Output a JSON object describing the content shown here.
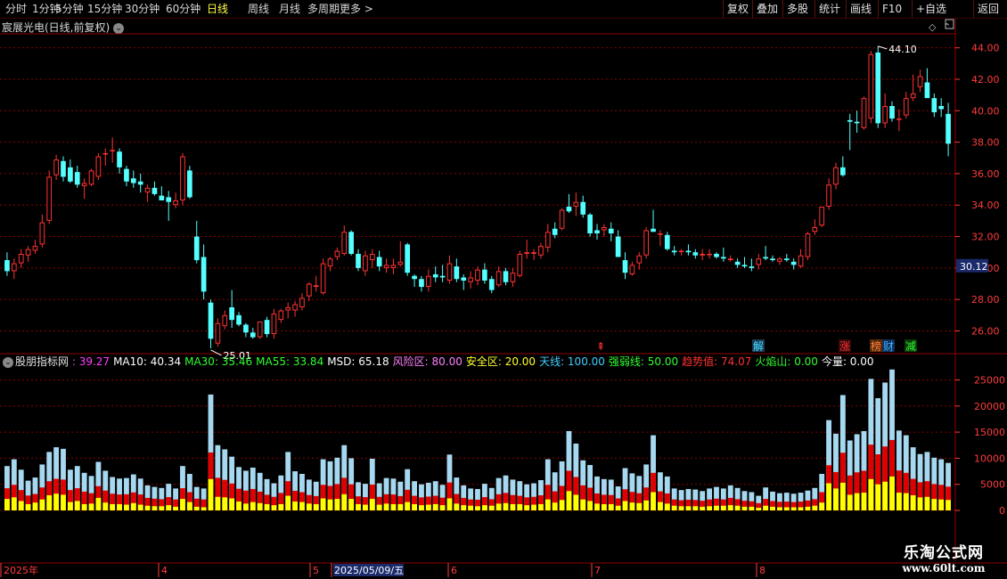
{
  "toolbar": {
    "left": [
      "分时",
      "1分钟",
      "5分钟",
      "15分钟",
      "30分钟",
      "60分钟",
      "日线",
      "周线",
      "月线",
      "多周期",
      "更多 >"
    ],
    "selected": "日线",
    "right": [
      "复权",
      "叠加",
      "多股",
      "统计",
      "画线",
      "F10",
      "+自选",
      "返回"
    ]
  },
  "stock": {
    "title": "宸展光电(日线,前复权)"
  },
  "price_axis": {
    "ticks": [
      "44.00",
      "42.00",
      "40.00",
      "38.00",
      "36.00",
      "34.00",
      "32.00",
      "30.00",
      "28.00",
      "26.00"
    ],
    "current": "30.12"
  },
  "annotations": {
    "high": "44.10",
    "low": "25.01"
  },
  "signals": [
    {
      "text": "⇞",
      "color": "#ff3030"
    },
    {
      "text": "解",
      "color": "#40e0ff"
    },
    {
      "text": "涨",
      "color": "#ff3030"
    },
    {
      "text": "榜",
      "color": "#ff8040"
    },
    {
      "text": "财",
      "color": "#40b0ff"
    },
    {
      "text": "减",
      "color": "#30ff30"
    }
  ],
  "indicator": {
    "name": "股朋指标网",
    "values": [
      {
        "text": ": 39.27",
        "color": "#ff40ff"
      },
      {
        "text": "MA10: 40.34",
        "color": "#ffffff"
      },
      {
        "text": "MA30: 35.46",
        "color": "#30ff30"
      },
      {
        "text": "MA55: 33.84",
        "color": "#30ff30"
      },
      {
        "text": "MSD: 65.18",
        "color": "#ffffff"
      },
      {
        "text": "风险区: 80.00",
        "color": "#ff80ff"
      },
      {
        "text": "安全区: 20.00",
        "color": "#ffff30"
      },
      {
        "text": "天线: 100.00",
        "color": "#40d0ff"
      },
      {
        "text": "强弱线: 50.00",
        "color": "#30ff30"
      },
      {
        "text": "趋势值: 74.07",
        "color": "#ff3030"
      },
      {
        "text": "火焰山: 0.00",
        "color": "#30ff30"
      },
      {
        "text": "今量: 0.00",
        "color": "#ffffff"
      }
    ]
  },
  "volume_axis": {
    "ticks": [
      "25000",
      "20000",
      "15000",
      "10000",
      "5000",
      "0"
    ]
  },
  "date_axis": [
    "2025年",
    "4",
    "5",
    "2025/05/09/五",
    "6",
    "7",
    "8"
  ],
  "watermark": {
    "line1": "乐淘公式网",
    "line2": "www.60lt.com"
  },
  "colors": {
    "up": "#ff3232",
    "down": "#54ffff",
    "grid": "#8b0000",
    "yellow": "#ffff00",
    "lightblue": "#a6d8f0"
  },
  "chart_data": {
    "type": "candlestick",
    "ylim": [
      24.5,
      45.0
    ],
    "candles": [
      [
        30.5,
        31.0,
        29.5,
        29.8
      ],
      [
        29.8,
        30.6,
        29.3,
        30.3
      ],
      [
        30.3,
        31.2,
        30.0,
        30.9
      ],
      [
        30.8,
        31.4,
        30.4,
        31.2
      ],
      [
        31.1,
        31.8,
        30.9,
        31.4
      ],
      [
        31.5,
        33.4,
        31.3,
        32.9
      ],
      [
        33.0,
        36.2,
        32.8,
        35.8
      ],
      [
        35.9,
        37.2,
        35.6,
        36.9
      ],
      [
        36.8,
        37.1,
        35.5,
        35.8
      ],
      [
        36.4,
        36.9,
        35.4,
        35.5
      ],
      [
        36.1,
        36.5,
        35.1,
        35.3
      ],
      [
        35.2,
        35.7,
        34.4,
        35.4
      ],
      [
        35.3,
        36.3,
        35.2,
        36.2
      ],
      [
        35.8,
        37.3,
        35.6,
        37.1
      ],
      [
        37.3,
        37.6,
        36.5,
        37.3
      ],
      [
        37.5,
        38.3,
        36.7,
        37.5
      ],
      [
        37.4,
        37.6,
        36.0,
        36.4
      ],
      [
        36.3,
        36.5,
        35.2,
        35.5
      ],
      [
        35.7,
        36.2,
        35.1,
        35.4
      ],
      [
        35.5,
        36.0,
        34.8,
        35.3
      ],
      [
        34.8,
        35.3,
        34.2,
        35.1
      ],
      [
        35.1,
        35.5,
        34.6,
        34.7
      ],
      [
        34.6,
        35.2,
        34.3,
        34.3
      ],
      [
        34.5,
        34.9,
        33.0,
        34.2
      ],
      [
        34.0,
        34.8,
        33.8,
        34.3
      ],
      [
        34.3,
        37.3,
        34.0,
        37.1
      ],
      [
        36.2,
        36.5,
        34.4,
        34.5
      ],
      [
        32.0,
        33.0,
        30.3,
        30.5
      ],
      [
        30.7,
        31.5,
        28.0,
        28.5
      ],
      [
        27.8,
        28.0,
        24.9,
        25.5
      ],
      [
        25.2,
        26.8,
        25.0,
        26.5
      ],
      [
        26.3,
        27.3,
        26.1,
        27.0
      ],
      [
        27.5,
        28.6,
        26.2,
        26.7
      ],
      [
        27.0,
        27.2,
        26.3,
        26.4
      ],
      [
        26.4,
        26.5,
        25.6,
        25.9
      ],
      [
        25.9,
        26.2,
        25.5,
        25.6
      ],
      [
        25.6,
        26.6,
        25.5,
        26.6
      ],
      [
        26.7,
        26.9,
        25.6,
        25.8
      ],
      [
        25.8,
        27.4,
        25.5,
        27.1
      ],
      [
        26.7,
        27.4,
        26.5,
        27.3
      ],
      [
        27.3,
        27.8,
        26.8,
        27.5
      ],
      [
        27.3,
        27.9,
        26.9,
        27.7
      ],
      [
        27.5,
        28.4,
        27.3,
        28.1
      ],
      [
        28.2,
        29.1,
        27.9,
        29.0
      ],
      [
        28.8,
        29.5,
        28.5,
        28.9
      ],
      [
        28.4,
        30.6,
        28.3,
        30.3
      ],
      [
        30.1,
        30.7,
        29.8,
        30.6
      ],
      [
        30.7,
        31.3,
        30.5,
        31.1
      ],
      [
        30.9,
        32.7,
        30.8,
        32.3
      ],
      [
        32.3,
        32.4,
        30.8,
        30.9
      ],
      [
        30.9,
        31.2,
        29.8,
        30.0
      ],
      [
        29.8,
        31.1,
        29.5,
        30.8
      ],
      [
        30.5,
        31.2,
        30.0,
        30.9
      ],
      [
        30.7,
        31.1,
        29.8,
        30.1
      ],
      [
        30.0,
        30.6,
        29.7,
        30.2
      ],
      [
        30.0,
        30.6,
        29.6,
        30.2
      ],
      [
        30.2,
        31.7,
        30.1,
        30.4
      ],
      [
        31.5,
        31.6,
        29.5,
        29.7
      ],
      [
        29.5,
        29.6,
        28.8,
        29.3
      ],
      [
        29.3,
        29.5,
        28.5,
        28.8
      ],
      [
        28.8,
        29.9,
        28.5,
        29.5
      ],
      [
        29.6,
        30.1,
        29.1,
        29.4
      ],
      [
        29.5,
        30.2,
        29.1,
        29.4
      ],
      [
        29.2,
        30.8,
        29.0,
        30.3
      ],
      [
        30.1,
        30.6,
        29.1,
        29.3
      ],
      [
        29.4,
        29.6,
        28.6,
        29.2
      ],
      [
        29.1,
        29.8,
        28.7,
        29.4
      ],
      [
        29.2,
        30.1,
        28.9,
        29.9
      ],
      [
        29.9,
        30.3,
        29.0,
        29.2
      ],
      [
        29.3,
        29.5,
        28.4,
        28.6
      ],
      [
        28.9,
        30.1,
        28.8,
        29.8
      ],
      [
        29.8,
        30.0,
        28.9,
        29.1
      ],
      [
        29.1,
        30.0,
        28.8,
        29.7
      ],
      [
        29.5,
        31.1,
        29.4,
        30.9
      ],
      [
        30.9,
        31.8,
        30.6,
        31.0
      ],
      [
        30.9,
        31.2,
        30.5,
        31.0
      ],
      [
        30.8,
        31.6,
        30.6,
        31.4
      ],
      [
        31.3,
        32.8,
        31.0,
        32.3
      ],
      [
        32.5,
        32.9,
        31.9,
        32.1
      ],
      [
        32.5,
        33.8,
        32.4,
        33.7
      ],
      [
        33.9,
        34.7,
        33.5,
        33.6
      ],
      [
        33.9,
        34.8,
        33.3,
        34.2
      ],
      [
        34.2,
        34.6,
        33.2,
        33.4
      ],
      [
        33.4,
        33.5,
        32.0,
        32.2
      ],
      [
        32.4,
        32.8,
        31.8,
        32.2
      ],
      [
        32.4,
        32.8,
        32.0,
        32.6
      ],
      [
        32.5,
        32.9,
        31.7,
        32.2
      ],
      [
        32.0,
        32.4,
        31.0,
        30.7
      ],
      [
        30.5,
        31.0,
        29.3,
        29.7
      ],
      [
        29.6,
        30.4,
        29.5,
        30.2
      ],
      [
        30.3,
        31.0,
        29.9,
        30.8
      ],
      [
        30.8,
        32.6,
        30.6,
        32.4
      ],
      [
        32.5,
        33.7,
        32.3,
        32.3
      ],
      [
        32.2,
        32.4,
        31.4,
        32.2
      ],
      [
        32.1,
        32.3,
        31.1,
        31.2
      ],
      [
        31.1,
        31.4,
        30.8,
        31.0
      ],
      [
        31.1,
        31.2,
        30.8,
        31.1
      ],
      [
        31.1,
        31.5,
        30.8,
        31.0
      ],
      [
        31.0,
        31.2,
        30.6,
        30.8
      ],
      [
        30.8,
        31.2,
        30.5,
        30.9
      ],
      [
        30.9,
        31.2,
        30.6,
        30.9
      ],
      [
        30.9,
        31.0,
        30.6,
        30.7
      ],
      [
        30.7,
        31.3,
        30.4,
        30.6
      ],
      [
        30.5,
        30.8,
        30.4,
        30.6
      ],
      [
        30.4,
        30.6,
        30.0,
        30.2
      ],
      [
        30.2,
        30.7,
        30.0,
        30.1
      ],
      [
        30.1,
        30.6,
        29.8,
        30.0
      ],
      [
        30.2,
        30.9,
        29.9,
        30.6
      ],
      [
        30.7,
        31.4,
        30.5,
        30.6
      ],
      [
        30.6,
        30.8,
        30.4,
        30.5
      ],
      [
        30.4,
        30.7,
        30.2,
        30.6
      ],
      [
        30.6,
        30.9,
        30.4,
        30.5
      ],
      [
        30.4,
        30.6,
        29.9,
        30.2
      ],
      [
        30.1,
        31.2,
        30.0,
        30.8
      ],
      [
        30.7,
        32.3,
        30.5,
        32.2
      ],
      [
        32.3,
        33.1,
        32.1,
        32.6
      ],
      [
        32.7,
        33.9,
        32.6,
        33.9
      ],
      [
        33.9,
        35.7,
        33.7,
        35.3
      ],
      [
        35.3,
        36.7,
        35.0,
        36.4
      ],
      [
        36.4,
        37.1,
        35.8,
        35.9
      ],
      [
        39.4,
        39.8,
        37.5,
        39.3
      ],
      [
        39.3,
        40.0,
        38.6,
        39.2
      ],
      [
        38.9,
        40.9,
        38.8,
        40.8
      ],
      [
        39.5,
        43.8,
        39.2,
        43.6
      ],
      [
        43.7,
        44.1,
        38.9,
        39.2
      ],
      [
        39.2,
        41.1,
        38.9,
        40.3
      ],
      [
        40.3,
        40.6,
        39.3,
        39.5
      ],
      [
        39.5,
        40.1,
        38.7,
        39.5
      ],
      [
        39.7,
        41.2,
        39.5,
        40.8
      ],
      [
        40.8,
        42.3,
        40.6,
        41.1
      ],
      [
        41.5,
        42.6,
        41.2,
        42.2
      ],
      [
        41.8,
        42.7,
        41.0,
        40.8
      ],
      [
        40.8,
        41.1,
        39.6,
        39.9
      ],
      [
        40.3,
        40.8,
        39.6,
        40.1
      ],
      [
        39.8,
        40.5,
        37.1,
        37.9
      ]
    ],
    "volume": [
      [
        8500,
        2200
      ],
      [
        9800,
        2500
      ],
      [
        7800,
        1800
      ],
      [
        5700,
        1200
      ],
      [
        6300,
        1500
      ],
      [
        8800,
        2100
      ],
      [
        11200,
        2900
      ],
      [
        12100,
        3200
      ],
      [
        11800,
        3000
      ],
      [
        7800,
        1600
      ],
      [
        8500,
        1800
      ],
      [
        7200,
        1200
      ],
      [
        6600,
        1300
      ],
      [
        9300,
        2400
      ],
      [
        7600,
        1500
      ],
      [
        6400,
        1200
      ],
      [
        6100,
        1200
      ],
      [
        6200,
        1100
      ],
      [
        6900,
        1400
      ],
      [
        6100,
        1100
      ],
      [
        4800,
        900
      ],
      [
        4500,
        800
      ],
      [
        4300,
        800
      ],
      [
        5100,
        1000
      ],
      [
        4200,
        700
      ],
      [
        8500,
        2200
      ],
      [
        7000,
        1600
      ],
      [
        4500,
        700
      ],
      [
        4200,
        600
      ],
      [
        22200,
        6000
      ],
      [
        12500,
        2600
      ],
      [
        11700,
        2500
      ],
      [
        10300,
        2300
      ],
      [
        8300,
        1700
      ],
      [
        7600,
        1300
      ],
      [
        8200,
        1600
      ],
      [
        7200,
        1400
      ],
      [
        6000,
        1200
      ],
      [
        5200,
        1000
      ],
      [
        6700,
        1200
      ],
      [
        11200,
        2800
      ],
      [
        7500,
        1700
      ],
      [
        7000,
        1600
      ],
      [
        5900,
        1300
      ],
      [
        5500,
        1200
      ],
      [
        9800,
        2300
      ],
      [
        9400,
        2100
      ],
      [
        10100,
        2200
      ],
      [
        12500,
        3100
      ],
      [
        10000,
        2200
      ],
      [
        5400,
        1200
      ],
      [
        5100,
        1100
      ],
      [
        9900,
        2200
      ],
      [
        5200,
        1100
      ],
      [
        6200,
        1300
      ],
      [
        6100,
        1200
      ],
      [
        5500,
        1200
      ],
      [
        7900,
        1600
      ],
      [
        5600,
        1200
      ],
      [
        5000,
        1000
      ],
      [
        5300,
        1100
      ],
      [
        5600,
        1200
      ],
      [
        4900,
        1000
      ],
      [
        10700,
        2300
      ],
      [
        6300,
        1300
      ],
      [
        4800,
        1000
      ],
      [
        4200,
        900
      ],
      [
        4100,
        800
      ],
      [
        5100,
        1000
      ],
      [
        4300,
        900
      ],
      [
        6200,
        1300
      ],
      [
        6700,
        1400
      ],
      [
        5900,
        1200
      ],
      [
        5600,
        1200
      ],
      [
        5000,
        1000
      ],
      [
        5200,
        1100
      ],
      [
        5800,
        1200
      ],
      [
        9800,
        2100
      ],
      [
        7300,
        1500
      ],
      [
        9400,
        2000
      ],
      [
        15200,
        3700
      ],
      [
        12800,
        3000
      ],
      [
        9600,
        2100
      ],
      [
        8700,
        1800
      ],
      [
        6500,
        1300
      ],
      [
        6000,
        1200
      ],
      [
        5900,
        1200
      ],
      [
        4600,
        900
      ],
      [
        8100,
        1800
      ],
      [
        7100,
        1500
      ],
      [
        6600,
        1400
      ],
      [
        8800,
        1900
      ],
      [
        14400,
        3500
      ],
      [
        7300,
        1600
      ],
      [
        6500,
        1300
      ],
      [
        4200,
        900
      ],
      [
        3900,
        800
      ],
      [
        4100,
        800
      ],
      [
        4000,
        800
      ],
      [
        3700,
        700
      ],
      [
        4200,
        800
      ],
      [
        4500,
        900
      ],
      [
        4200,
        900
      ],
      [
        4800,
        1000
      ],
      [
        4300,
        900
      ],
      [
        3700,
        700
      ],
      [
        3500,
        700
      ],
      [
        2800,
        500
      ],
      [
        4400,
        900
      ],
      [
        3600,
        700
      ],
      [
        3300,
        600
      ],
      [
        3400,
        600
      ],
      [
        3200,
        600
      ],
      [
        3400,
        600
      ],
      [
        3800,
        700
      ],
      [
        4300,
        900
      ],
      [
        7000,
        1500
      ],
      [
        17300,
        5200
      ],
      [
        14700,
        4200
      ],
      [
        22100,
        5300
      ],
      [
        13400,
        3000
      ],
      [
        14600,
        3300
      ],
      [
        15200,
        3400
      ],
      [
        25200,
        6000
      ],
      [
        21500,
        5000
      ],
      [
        24500,
        5500
      ],
      [
        27000,
        6500
      ],
      [
        15300,
        3400
      ],
      [
        14400,
        3300
      ],
      [
        12100,
        2900
      ],
      [
        10800,
        2500
      ],
      [
        11200,
        2600
      ],
      [
        10100,
        2200
      ],
      [
        9800,
        2100
      ],
      [
        9100,
        2000
      ]
    ]
  }
}
